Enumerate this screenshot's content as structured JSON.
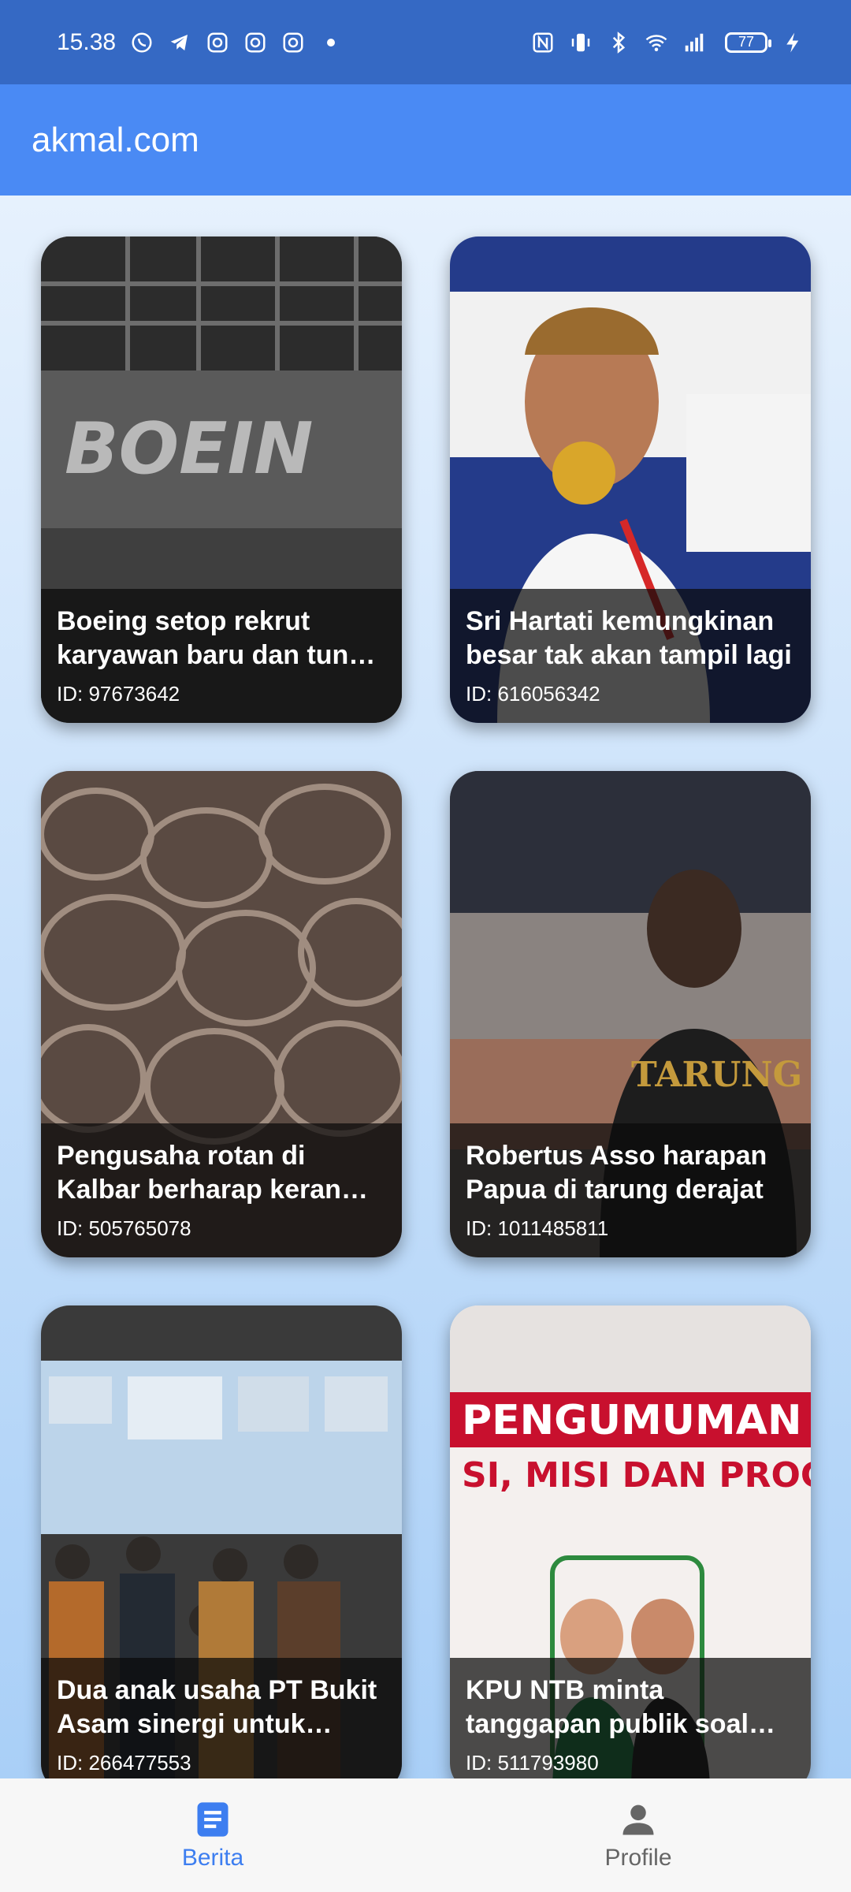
{
  "status_bar": {
    "time": "15.38",
    "battery": "77",
    "left_icons": [
      "whatsapp-icon",
      "telegram-icon",
      "instagram-icon",
      "instagram-icon",
      "instagram-icon",
      "dot-icon"
    ],
    "right_icons": [
      "nfc-icon",
      "vibrate-icon",
      "bluetooth-icon",
      "wifi-icon",
      "signal-icon",
      "battery-icon",
      "charging-icon"
    ]
  },
  "app_bar": {
    "title": "akmal.com"
  },
  "articles": [
    {
      "title": "Boeing setop rekrut karyawan baru dan tunda kenaikan gaji",
      "id_label": "ID: 97673642",
      "image": "boeing-building"
    },
    {
      "title": "Sri Hartati kemungkinan besar tak akan tampil lagi",
      "id_label": "ID: 616056342",
      "image": "athlete-gold-medal"
    },
    {
      "title": "Pengusaha rotan di Kalbar berharap keran ekspor dibuka",
      "id_label": "ID: 505765078",
      "image": "rattan-bundles"
    },
    {
      "title": "Robertus Asso harapan Papua di tarung derajat",
      "id_label": "ID: 1011485811",
      "image": "athlete-portrait"
    },
    {
      "title": "Dua anak usaha PT Bukit Asam sinergi untuk perkuat bisnis",
      "id_label": "ID: 266477553",
      "image": "signing-ceremony"
    },
    {
      "title": "KPU NTB minta tanggapan publik soal visi misi",
      "id_label": "ID: 511793980",
      "image": "announcement-poster"
    }
  ],
  "bottom_nav": {
    "items": [
      {
        "label": "Berita",
        "icon": "article-icon",
        "active": true
      },
      {
        "label": "Profile",
        "icon": "person-icon",
        "active": false
      }
    ]
  },
  "colors": {
    "status_bar": "#3569c4",
    "app_bar": "#4a8af4",
    "accent": "#3d7ef0"
  }
}
